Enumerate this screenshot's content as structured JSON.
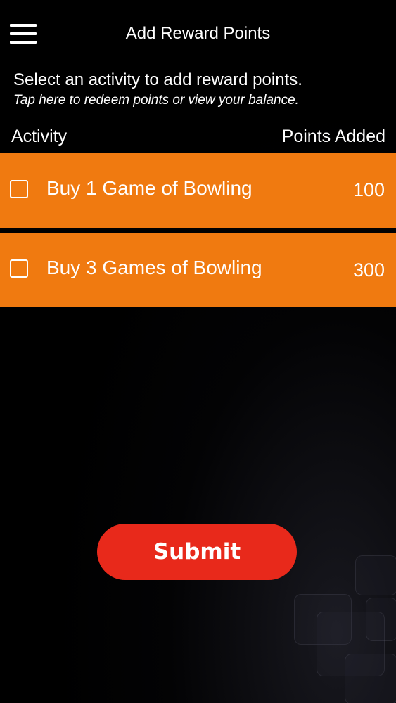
{
  "header": {
    "title": "Add Reward Points",
    "menu_icon": "hamburger-menu-icon"
  },
  "intro": {
    "instruction": "Select an activity to add reward points.",
    "redeem_link": "Tap here to redeem points or view your balance",
    "redeem_suffix": "."
  },
  "table": {
    "columns": [
      "Activity",
      "Points Added"
    ],
    "rows": [
      {
        "label": "Buy 1 Game of Bowling",
        "points": "100",
        "checked": false
      },
      {
        "label": "Buy 3 Games of Bowling",
        "points": "300",
        "checked": false
      }
    ]
  },
  "submit": {
    "label": "Submit"
  },
  "colors": {
    "background": "#000000",
    "row_background": "#f07a10",
    "submit_background": "#e8291b",
    "text": "#ffffff"
  }
}
